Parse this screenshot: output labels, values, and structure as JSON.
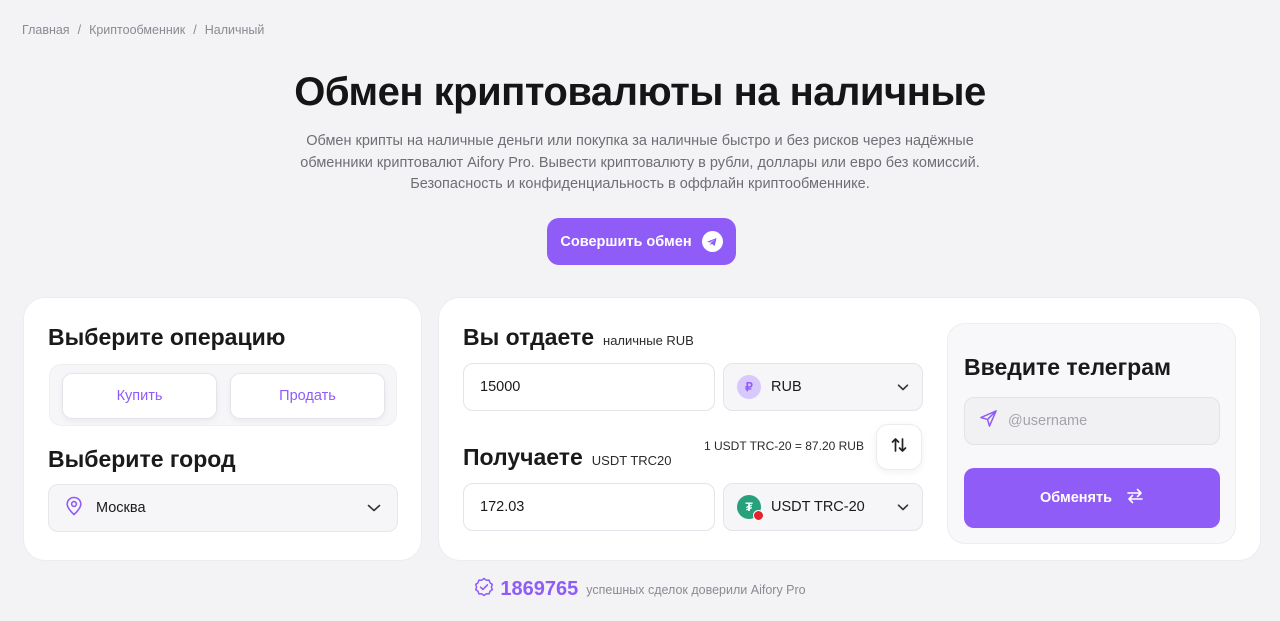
{
  "breadcrumb": {
    "items": [
      "Главная",
      "Криптообменник",
      "Наличный"
    ],
    "separator": "/"
  },
  "hero": {
    "title": "Обмен криптовалюты на наличные",
    "subtitle_lines": [
      "Обмен крипты на наличные деньги или покупка за наличные быстро и без рисков через надёжные",
      "обменники криптовалют Aifory Pro. Вывести криптовалюту в рубли, доллары или евро без комиссий.",
      "Безопасность и конфиденциальность в оффлайн криптообменнике."
    ],
    "cta_label": "Совершить обмен",
    "cta_icon": "telegram-icon"
  },
  "operation": {
    "title": "Выберите операцию",
    "buy_label": "Купить",
    "sell_label": "Продать"
  },
  "city": {
    "title": "Выберите город",
    "selected": "Москва",
    "icon": "location-pin-icon"
  },
  "give": {
    "title": "Вы отдаете",
    "hint": "наличные RUB",
    "amount": "15000",
    "currency": "RUB",
    "currency_icon": "ruble-coin-icon"
  },
  "receive": {
    "title": "Получаете",
    "hint": "USDT TRC20",
    "amount": "172.03",
    "currency": "USDT TRC-20",
    "currency_icon": "tether-coin-icon"
  },
  "rate": "1 USDT TRC-20 = 87.20 RUB",
  "telegram": {
    "title": "Введите телеграм",
    "placeholder": "@username",
    "submit_label": "Обменять",
    "submit_icon": "swap-arrows-icon"
  },
  "trust": {
    "count": "1869765",
    "text": "успешных сделок доверили Aifory Pro"
  },
  "colors": {
    "accent": "#8f5cf7",
    "background": "#f3f3f5",
    "card": "#ffffff",
    "tether": "#26a17b",
    "tron": "#e5212e"
  }
}
